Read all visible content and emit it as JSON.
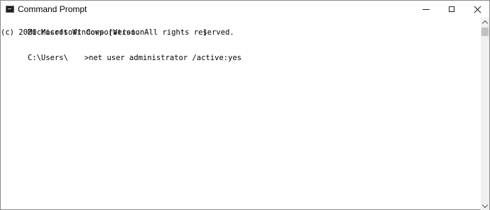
{
  "window": {
    "title": "Command Prompt",
    "icon": "cmd-icon"
  },
  "controls": {
    "minimize": "minimize-icon",
    "maximize": "maximize-icon",
    "close": "close-icon"
  },
  "console": {
    "line1_a": "Microsoft Windows [Version",
    "line1_b": "]",
    "line2": "(c) 2020 Microsoft Corporation. All rights reserved.",
    "prompt_a": "C:\\Users\\",
    "prompt_b": ">net user administrator /active:yes"
  },
  "scrollbar": {
    "up": "chevron-up-icon",
    "down": "chevron-down-icon"
  }
}
